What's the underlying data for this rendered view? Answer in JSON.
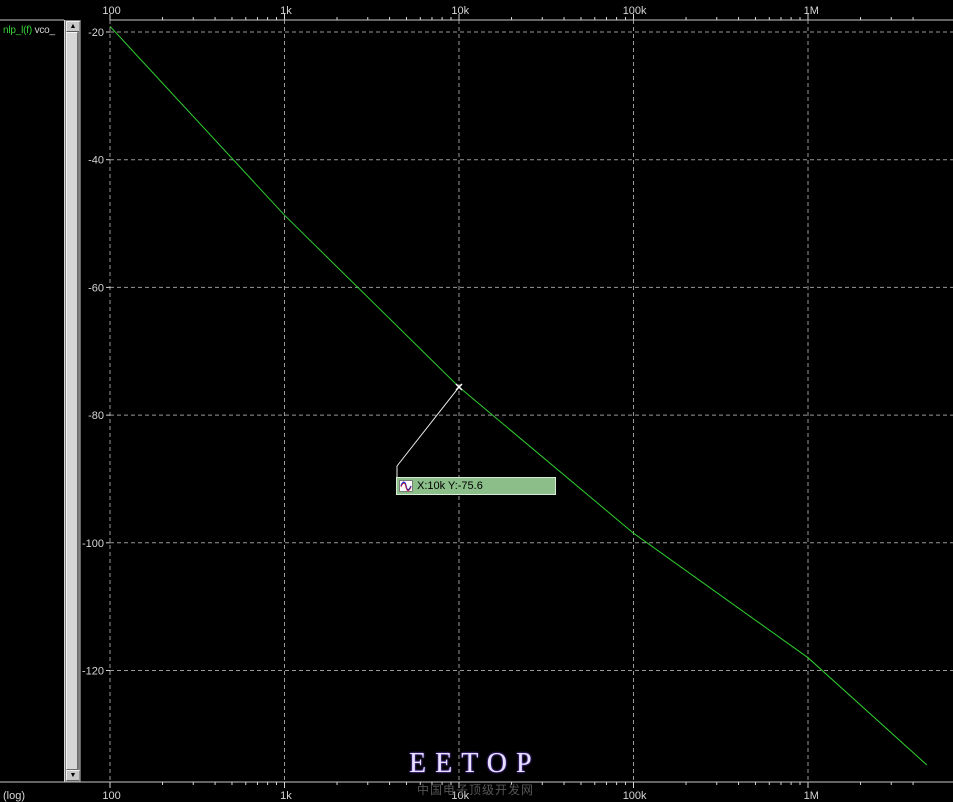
{
  "legend": {
    "signal_name": "nlp_l(f)",
    "signal_suffix": "vco_"
  },
  "bottom_left_label": "(log)",
  "cursor_readout": {
    "text": "X:10k Y:-75.6"
  },
  "watermark": {
    "text": "EETOP",
    "subtext": "中国电子顶级开发网"
  },
  "colors": {
    "trace": "#2fd02f",
    "grid": "#b4b4b4",
    "text": "#d6d6d6",
    "background": "#000000"
  },
  "chart_data": {
    "type": "line",
    "x_scale": "log",
    "xlim": [
      100,
      4800000
    ],
    "ylim": [
      -138,
      -18
    ],
    "x_ticks": [
      {
        "value": 100,
        "label": "100"
      },
      {
        "value": 1000,
        "label": "1k"
      },
      {
        "value": 10000,
        "label": "10k"
      },
      {
        "value": 100000,
        "label": "100k"
      },
      {
        "value": 1000000,
        "label": "1M"
      }
    ],
    "y_ticks": [
      {
        "value": -20,
        "label": "-20"
      },
      {
        "value": -40,
        "label": "-40"
      },
      {
        "value": -60,
        "label": "-60"
      },
      {
        "value": -80,
        "label": "-80"
      },
      {
        "value": -100,
        "label": "-100"
      },
      {
        "value": -120,
        "label": "-120"
      }
    ],
    "grid": true,
    "series": [
      {
        "name": "nlp_l(f) vco_",
        "x": [
          100,
          1000,
          10000,
          100000,
          1000000,
          4800000
        ],
        "y": [
          -19.1,
          -48.7,
          -75.6,
          -98.5,
          -118.0,
          -134.8
        ]
      }
    ],
    "marker": {
      "x": 10000,
      "y": -75.6
    }
  }
}
